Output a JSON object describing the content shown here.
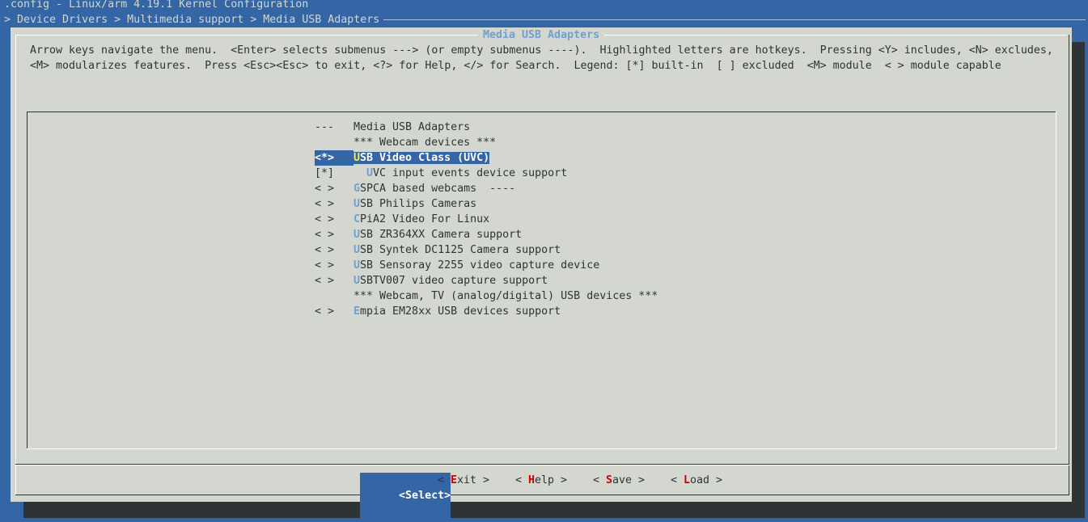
{
  "window": {
    "title": ".config - Linux/arm 4.19.1 Kernel Configuration",
    "breadcrumb": "> Device Drivers > Multimedia support > Media USB Adapters"
  },
  "dialog": {
    "title": "Media USB Adapters",
    "help_line_1": "Arrow keys navigate the menu.  <Enter> selects submenus ---> (or empty submenus ----).  Highlighted letters are hotkeys.  Pressing <Y> includes, <N> excludes,",
    "help_line_2": "<M> modularizes features.  Press <Esc><Esc> to exit, <?> for Help, </> for Search.  Legend: [*] built-in  [ ] excluded  <M> module  < > module capable"
  },
  "menu": {
    "items": [
      {
        "prefix": "--- ",
        "hotkey": "",
        "rest": "Media USB Adapters",
        "indent": ""
      },
      {
        "prefix": "    ",
        "hotkey": "",
        "rest": "*** Webcam devices ***",
        "indent": ""
      },
      {
        "prefix": "<*>",
        "hotkey": "U",
        "rest": "SB Video Class (UVC)",
        "indent": "",
        "selected": true
      },
      {
        "prefix": "[*]",
        "hotkey": "U",
        "rest": "VC input events device support",
        "indent": "  "
      },
      {
        "prefix": "< >",
        "hotkey": "G",
        "rest": "SPCA based webcams  ----",
        "indent": ""
      },
      {
        "prefix": "< >",
        "hotkey": "U",
        "rest": "SB Philips Cameras",
        "indent": ""
      },
      {
        "prefix": "< >",
        "hotkey": "C",
        "rest": "PiA2 Video For Linux",
        "indent": ""
      },
      {
        "prefix": "< >",
        "hotkey": "U",
        "rest": "SB ZR364XX Camera support",
        "indent": ""
      },
      {
        "prefix": "< >",
        "hotkey": "U",
        "rest": "SB Syntek DC1125 Camera support",
        "indent": ""
      },
      {
        "prefix": "< >",
        "hotkey": "U",
        "rest": "SB Sensoray 2255 video capture device",
        "indent": ""
      },
      {
        "prefix": "< >",
        "hotkey": "U",
        "rest": "SBTV007 video capture support",
        "indent": ""
      },
      {
        "prefix": "    ",
        "hotkey": "",
        "rest": "*** Webcam, TV (analog/digital) USB devices ***",
        "indent": ""
      },
      {
        "prefix": "< >",
        "hotkey": "E",
        "rest": "mpia EM28xx USB devices support",
        "indent": ""
      }
    ]
  },
  "buttons": {
    "select": "<Select>",
    "exit_pre": "< ",
    "exit_key": "E",
    "exit_rest": "xit >",
    "help_pre": "< ",
    "help_key": "H",
    "help_rest": "elp >",
    "save_pre": "< ",
    "save_key": "S",
    "save_rest": "ave >",
    "load_pre": "< ",
    "load_key": "L",
    "load_rest": "oad >"
  },
  "colors": {
    "background": "#3465a4",
    "dialog": "#d3d7cf",
    "hotkey": "#729fcf",
    "button_hotkey": "#cc0000",
    "selection": "#3465a4"
  }
}
